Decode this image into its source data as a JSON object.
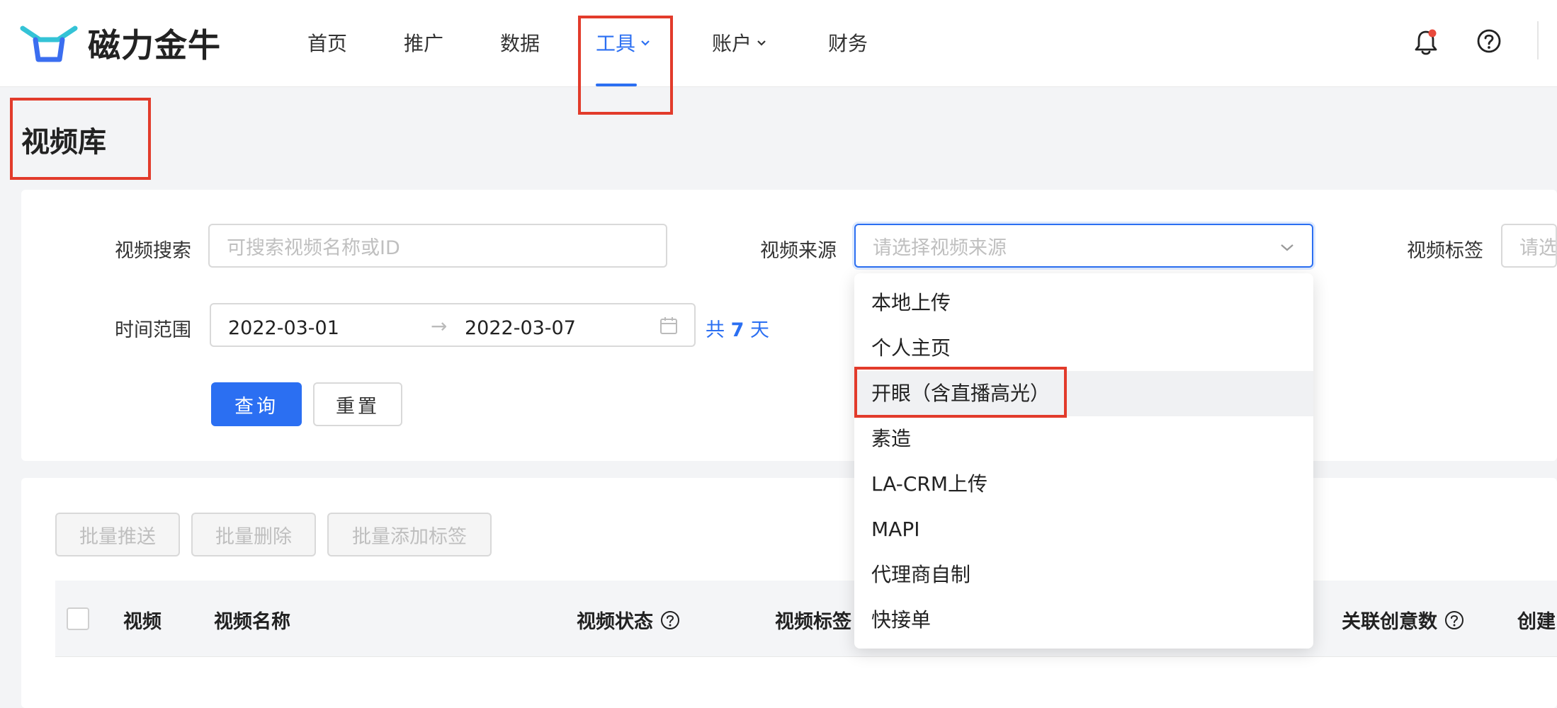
{
  "header": {
    "logo_text": "磁力金牛",
    "nav": [
      "首页",
      "推广",
      "数据",
      "工具",
      "账户",
      "财务"
    ],
    "active_nav": "工具"
  },
  "page": {
    "title": "视频库"
  },
  "filters": {
    "search_label": "视频搜索",
    "search_placeholder": "可搜索视频名称或ID",
    "source_label": "视频来源",
    "source_placeholder": "请选择视频来源",
    "tag_label": "视频标签",
    "tag_placeholder": "请选",
    "time_label": "时间范围",
    "date_start": "2022-03-01",
    "date_end": "2022-03-07",
    "days_prefix": "共",
    "days_count": "7",
    "days_suffix": "天",
    "query_btn": "查询",
    "reset_btn": "重置"
  },
  "batch_actions": [
    "批量推送",
    "批量删除",
    "批量添加标签"
  ],
  "table": {
    "columns": [
      "视频",
      "视频名称",
      "视频状态",
      "视频标签",
      "关联创意数",
      "创建"
    ]
  },
  "dropdown": {
    "options": [
      "本地上传",
      "个人主页",
      "开眼（含直播高光）",
      "素造",
      "LA-CRM上传",
      "MAPI",
      "代理商自制",
      "快接单"
    ],
    "highlighted_index": 2
  },
  "colors": {
    "accent": "#2b6ff2",
    "annotation": "#e23b2b"
  }
}
